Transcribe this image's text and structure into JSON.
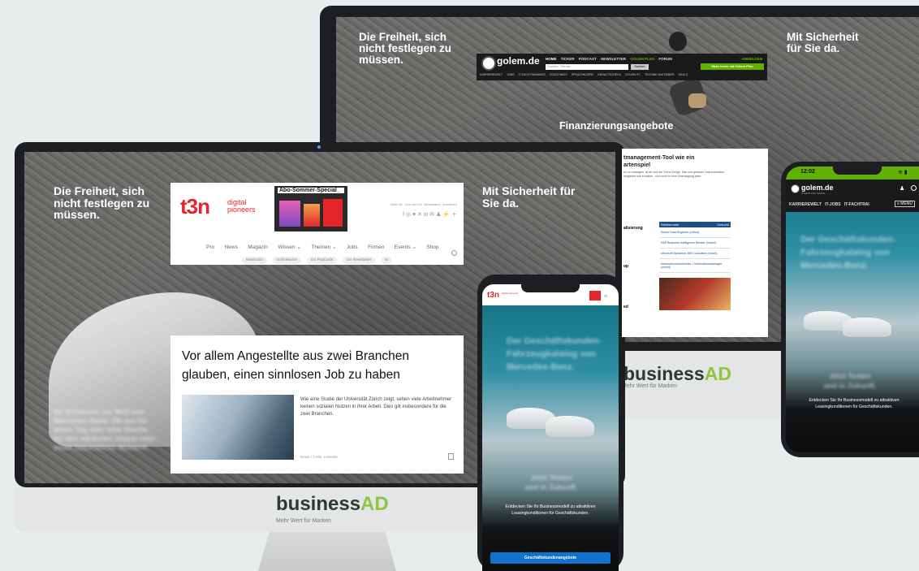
{
  "colors": {
    "background": "#e7ecec",
    "bezel": "#1c1e22",
    "brand_dark": "#2b3a2e",
    "brand_green": "#8dc63f",
    "t3n_red": "#e3262c",
    "golem_green": "#61b200",
    "cta_blue": "#1173c9"
  },
  "back_monitor": {
    "headline_left": "Die Freiheit, sich nicht festlegen zu müssen.",
    "headline_right": "Mit Sicherheit für Sie da.",
    "center_text": "Finanzierungsangebote",
    "golem": {
      "logo": "golem.de",
      "tagline": "IT-NEWS FÜR PROFIS",
      "nav": [
        "HOME",
        "TICKER",
        "PODCAST",
        "NEWSLETTER",
        "GOLEM PLUS",
        "FORUM"
      ],
      "login": "ANMELDEN",
      "search_placeholder": "Suchen, Thema…",
      "search_button": "Suchen",
      "plus_button": "Mehr lesen mit Golem Plus",
      "subnav": [
        "KARRIEREWELT",
        "JOBS",
        "IT-FACHTRAININGS",
        "COACHINGS",
        "SPRACHKURSE",
        "GEHALTSCHECK",
        "GOLEM PC",
        "TECHNIK-RATGEBER",
        "DEALS"
      ]
    },
    "article": {
      "title_line1": "tmanagement-Tool wie ein",
      "title_line2": "artenspiel",
      "teaser": "en zu managen, ist alt und der Trend-Einige. Das neu gebaute Dokumentation vergleicht wie komplex - und nicht hr eine Übertragung wein.",
      "side_item1": "alisierung",
      "side_item2": "op",
      "side_item3": "ed"
    },
    "jobs": {
      "title": "Stellenmarkt",
      "more": "Gesucht",
      "items": [
        "Senior Data Engineer (m/w/d)",
        "SAP Business Intelligence Berater (m/w/d)",
        "Microsoft Dynamics 365 Consultant (m/w/d)",
        "Informationssicherheits- / Informationsmanager (m/w/d)"
      ]
    },
    "brand": "business",
    "brand_ad": "AD",
    "brand_sub": "Mehr Wert für Marken"
  },
  "front_monitor": {
    "headline_left": "Die Freiheit, sich nicht festlegen zu müssen.",
    "headline_right": "Mit Sicherheit für Sie da.",
    "blur_text": "Ihr Schlüssel zur Welt von Mercedes-Benz: Ob nur für einen Tag oder eine Woche, für den nächsten Urlaub oder einen besonderen Moment.",
    "t3n": {
      "logo": "t3n",
      "logo_sub1": "digital",
      "logo_sub2": "pioneers",
      "promo": "Abo-Sommer-Special_",
      "util_links": [
        "Über t3n",
        "Jobs bei t3n",
        "Mediadaten",
        "Anmelden"
      ],
      "nav": [
        "Pro",
        "News",
        "Magazin",
        "Wissen ⌄",
        "Themen ⌄",
        "Jobs",
        "Firmen",
        "Events ⌄",
        "Shop"
      ],
      "pills": [
        "Mastodon",
        "Onlinekurse",
        "t3n Podcasts",
        "t3n Newsletter",
        "KI"
      ],
      "social_icons": "f ◎ ♥ ✕ in ✉ ♟ ⚡ ＋"
    },
    "article": {
      "title": "Vor allem Angestellte aus zwei Branchen glauben, einen sinnlosen Job zu haben",
      "teaser": "Wie eine Studie der Universität Zürich zeigt, sehen viele Arbeitnehmer keinen sozialen Nutzen in ihrer Arbeit. Dies gilt insbesondere für die zwei Branchen.",
      "meta_type": "News",
      "meta_time": "2 Min. Lesezeit"
    },
    "brand": "business",
    "brand_ad": "AD",
    "brand_sub": "Mehr Wert für Marken"
  },
  "phone_center": {
    "logo": "t3n",
    "logo_sub": "digital pioneers",
    "blur_headline": "Der Geschäftskunden-Fahrzeugkatalog von Mercedes-Benz.",
    "blur_sub": "Jetzt Testen und in Zukunft.",
    "caption": "Entdecken Sie Ihr Businessmodell zu attraktiven Leasingkonditionen für Geschäftskunden.",
    "cta": "Geschäftskundenangebote"
  },
  "phone_right": {
    "time": "12:02",
    "logo": "golem.de",
    "tagline": "IT-NEWS FÜR PROFIS",
    "nav": [
      "KARRIEREWELT",
      "IT-JOBS",
      "IT-FACHTRAI"
    ],
    "menu": "≡ MENÜ",
    "blur_headline": "Der Geschäftskunden-Fahrzeugkatalog von Mercedes-Benz.",
    "blur_sub": "Jetzt Testen und in Zukunft.",
    "caption": "Entdecken Sie Ihr Businessmodell zu attraktiven Leasingkonditionen für Geschäftskunden."
  }
}
